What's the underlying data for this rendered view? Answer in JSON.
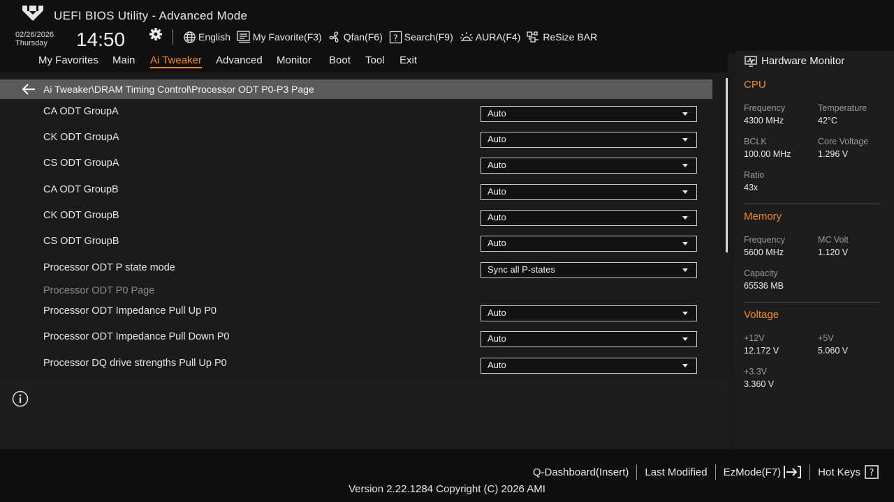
{
  "header": {
    "title": "UEFI BIOS Utility - Advanced Mode",
    "date": "02/26/2026",
    "weekday": "Thursday",
    "time": "14:50"
  },
  "toolbar": {
    "language": "English",
    "favorite": "My Favorite(F3)",
    "qfan": "Qfan(F6)",
    "search": "Search(F9)",
    "aura": "AURA(F4)",
    "resize_bar": "ReSize BAR"
  },
  "nav": {
    "tabs": [
      {
        "label": "My Favorites"
      },
      {
        "label": "Main"
      },
      {
        "label": "Ai Tweaker",
        "active": true
      },
      {
        "label": "Advanced"
      },
      {
        "label": "Monitor"
      },
      {
        "label": "Boot"
      },
      {
        "label": "Tool"
      },
      {
        "label": "Exit"
      }
    ]
  },
  "main": {
    "breadcrumb": "Ai Tweaker\\DRAM Timing Control\\Processor ODT P0-P3 Page",
    "settings": [
      {
        "label": "CA ODT GroupA",
        "value": "Auto"
      },
      {
        "label": "CK ODT GroupA",
        "value": "Auto"
      },
      {
        "label": "CS ODT GroupA",
        "value": "Auto"
      },
      {
        "label": "CA ODT GroupB",
        "value": "Auto"
      },
      {
        "label": "CK ODT GroupB",
        "value": "Auto"
      },
      {
        "label": "CS ODT GroupB",
        "value": "Auto"
      },
      {
        "label": "Processor ODT P state mode",
        "value": "Sync all P-states"
      },
      {
        "label": "Processor ODT P0 Page",
        "value": null
      },
      {
        "label": "Processor ODT Impedance Pull Up P0",
        "value": "Auto"
      },
      {
        "label": "Processor ODT Impedance Pull Down P0",
        "value": "Auto"
      },
      {
        "label": "Processor DQ drive strengths Pull Up P0",
        "value": "Auto"
      }
    ]
  },
  "hw_monitor": {
    "title": "Hardware Monitor",
    "cpu": {
      "title": "CPU",
      "frequency_label": "Frequency",
      "frequency": "4300 MHz",
      "temperature_label": "Temperature",
      "temperature": "42°C",
      "bclk_label": "BCLK",
      "bclk": "100.00 MHz",
      "core_voltage_label": "Core Voltage",
      "core_voltage": "1.296 V",
      "ratio_label": "Ratio",
      "ratio": "43x"
    },
    "memory": {
      "title": "Memory",
      "frequency_label": "Frequency",
      "frequency": "5600 MHz",
      "mc_volt_label": "MC Volt",
      "mc_volt": "1.120 V",
      "capacity_label": "Capacity",
      "capacity": "65536 MB"
    },
    "voltage": {
      "title": "Voltage",
      "v12_label": "+12V",
      "v12": "12.172 V",
      "v5_label": "+5V",
      "v5": "5.060 V",
      "v33_label": "+3.3V",
      "v33": "3.360 V"
    }
  },
  "footer": {
    "qdashboard": "Q-Dashboard(Insert)",
    "last_modified": "Last Modified",
    "ezmode": "EzMode(F7)",
    "hotkeys": "Hot Keys",
    "copyright": "Version 2.22.1284 Copyright (C) 2026 AMI"
  },
  "colors": {
    "accent": "#f08a2a",
    "background": "#1a1a1a",
    "breadcrumb_bg": "#5a5a5a"
  }
}
